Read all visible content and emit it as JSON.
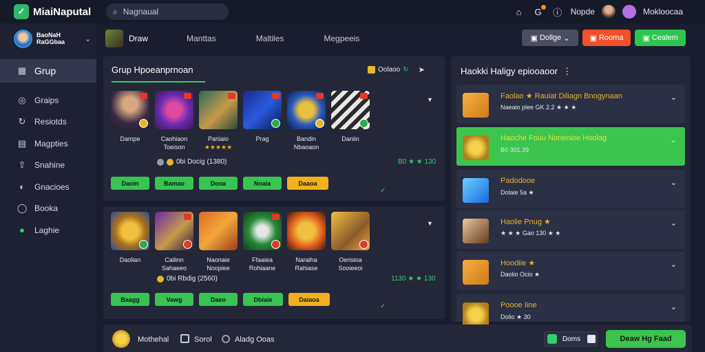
{
  "app": {
    "title": "MiaiNaputal",
    "accent": "#2fd06a"
  },
  "search": {
    "value": "Nagnaual"
  },
  "topbar": {
    "user_text": "Nopde",
    "user2_text": "Mokloocaa"
  },
  "sidebar": {
    "profile_name": "BaoNaH RaGGbaa",
    "items": [
      {
        "label": "Grup",
        "icon": "grid-icon"
      },
      {
        "label": "Graips",
        "icon": "gamepad-icon"
      },
      {
        "label": "Resiotds",
        "icon": "refresh-icon"
      },
      {
        "label": "Magpties",
        "icon": "chart-icon"
      },
      {
        "label": "Snahine",
        "icon": "share-icon"
      },
      {
        "label": "Gnacioes",
        "icon": "game-icon"
      },
      {
        "label": "Booka",
        "icon": "settings-icon"
      },
      {
        "label": "Laghie",
        "icon": "green-circle-icon"
      }
    ]
  },
  "header": {
    "name": "Draw",
    "tabs": [
      "Manttas",
      "Maltiles",
      "Megpeeis"
    ],
    "buttons": {
      "dropdown": "Dollge",
      "red": "Rooma",
      "green": "Cealem"
    }
  },
  "panel_a": {
    "title": "Grup Hpoeanprnoan",
    "meta": "Oolaoo",
    "games": [
      {
        "name": "Dampe",
        "name2": ""
      },
      {
        "name": "Caohiaon",
        "name2": "Toeison"
      },
      {
        "name": "Pariiaio",
        "name2": "★★★★★"
      },
      {
        "name": "Prag",
        "name2": ""
      },
      {
        "name": "Bandin",
        "name2": "Nbaoaon"
      },
      {
        "name": "Daniin",
        "name2": ""
      }
    ],
    "info": "0bi  Docig (1380)",
    "score": "B0 ★ ★ 130",
    "chips": [
      "Daoin",
      "Bamao",
      "Dooa",
      "Noaia",
      "Daaoa"
    ]
  },
  "panel_b": {
    "games": [
      {
        "name": "Daolian",
        "name2": ""
      },
      {
        "name": "Cailinn",
        "name2": "Sahaeeo"
      },
      {
        "name": "Naonaie",
        "name2": "Noopiee"
      },
      {
        "name": "Ffaaiea",
        "name2": "Rohiaane"
      },
      {
        "name": "Naraiha",
        "name2": "Rahiase"
      },
      {
        "name": "Oerisioa",
        "name2": "Sooieeoi"
      }
    ],
    "info": "0bi  Rbdig (2560)",
    "score": "1130 ★ ★ 130",
    "chips": [
      "Baagg",
      "Vawg",
      "Daeo",
      "Dbiaie",
      "Daiaoa"
    ]
  },
  "right_panel": {
    "title": "Haokki Haligy epiooaoor",
    "items": [
      {
        "line1": "Faolao ★ Rauiat Diliagn Bnogynaan",
        "line2": "Naeaio plee  GK 2.2  ★ ★ ★",
        "active": false
      },
      {
        "line1": "Haoche Fouu Nonenioe Hoolag",
        "line2": "B0 301.39",
        "active": true
      },
      {
        "line1": "Padodooe",
        "line2": "Dolaie 5a  ★",
        "active": false
      },
      {
        "line1": "Haolie Pnug ★",
        "line2": "★ ★ ★  Gao 130 ★ ★",
        "active": false
      },
      {
        "line1": "Hoodiie ★",
        "line2": "Daolio Ocio  ★",
        "active": false
      },
      {
        "line1": "Poooe Iine",
        "line2": "Dolio ★ 30",
        "active": false
      }
    ]
  },
  "bottom": {
    "label1": "Mothehal",
    "label2": "Sorol",
    "label3": "Aladg Ooas",
    "btn1": "Doms",
    "btn2": "Deaw Hg Faad"
  }
}
